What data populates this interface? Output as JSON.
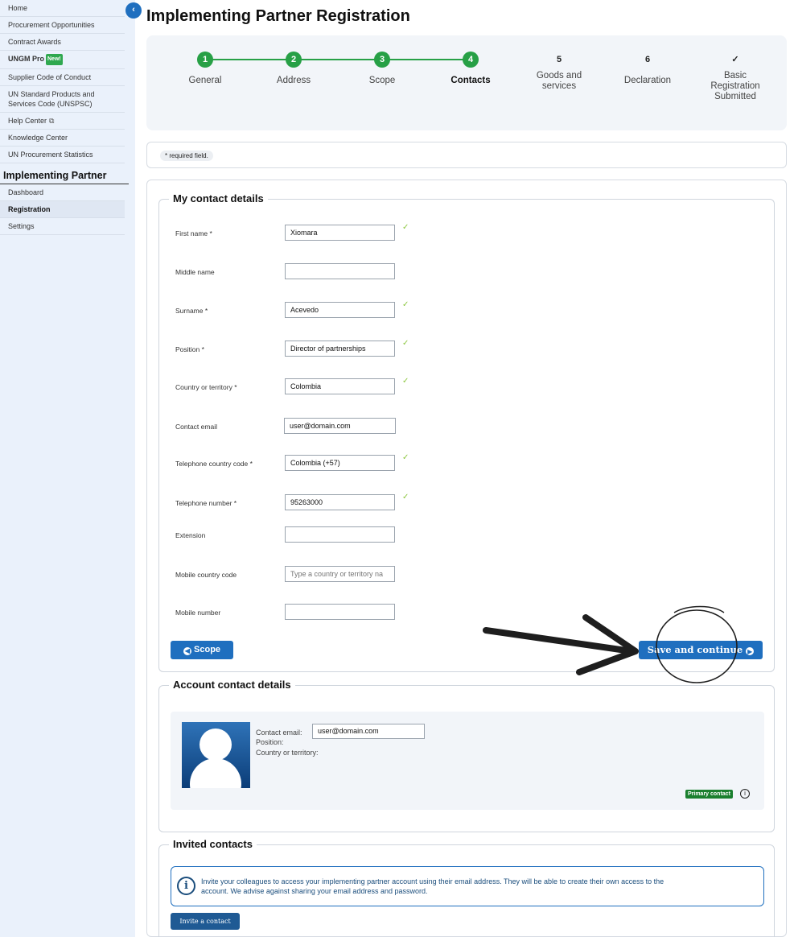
{
  "sidebar": {
    "links": [
      "Home",
      "Procurement Opportunities",
      "Contract Awards"
    ],
    "ungm_pro": "UNGM Pro",
    "new_badge": "New!",
    "links2": [
      "Supplier Code of Conduct",
      "UN Standard Products and",
      "Services Code (UNSPSC)"
    ],
    "help_center": "Help Center",
    "links3": [
      "Knowledge Center",
      "UN Procurement Statistics"
    ],
    "section": "Implementing Partner",
    "section_items": [
      "Dashboard",
      "Registration",
      "Settings"
    ]
  },
  "page": {
    "title": "Implementing Partner Registration"
  },
  "steps": [
    {
      "num": "1",
      "label": "General"
    },
    {
      "num": "2",
      "label": "Address"
    },
    {
      "num": "3",
      "label": "Scope"
    },
    {
      "num": "4",
      "label": "Contacts"
    },
    {
      "num": "5",
      "label_1": "Goods and",
      "label_2": "services"
    },
    {
      "num": "6",
      "label": "Declaration"
    },
    {
      "num": "✓",
      "label_1": "Basic",
      "label_2": "Registration",
      "label_3": "Submitted"
    }
  ],
  "required_note": "* required field.",
  "my_contact": {
    "legend": "My contact details",
    "fields": [
      {
        "label": "First name *",
        "value": "Xiomara"
      },
      {
        "label": "Middle name",
        "value": ""
      },
      {
        "label": "Surname *",
        "value": "Acevedo"
      },
      {
        "label": "Position *",
        "value": "Director of partnerships"
      },
      {
        "label": "Country or territory *",
        "value": "Colombia"
      },
      {
        "label": "Contact email",
        "value": "user@domain.com"
      },
      {
        "label": "Telephone country code *",
        "value": "Colombia (+57)"
      },
      {
        "label": "Telephone number *",
        "value": "95263000"
      },
      {
        "label": "Extension",
        "value": ""
      },
      {
        "label": "Mobile country code",
        "value": "",
        "placeholder": "Type a country or territory na"
      },
      {
        "label": "Mobile number",
        "value": ""
      }
    ],
    "back_button": "Scope",
    "save_button": "Save and continue"
  },
  "account_contact": {
    "legend": "Account contact details",
    "email_label": "Contact email:",
    "email_value": "user@domain.com",
    "position_label": "Position:",
    "country_label": "Country or territory:",
    "primary_badge": "Primary contact"
  },
  "invited": {
    "legend": "Invited contacts",
    "info_line1": "Invite your colleagues to access your implementing partner account using their email address. They will be able to create their own access to the",
    "info_line2": "account. We advise against sharing your email address and password.",
    "invite_button": "Invite a contact"
  },
  "colors": {
    "primary": "#1f6fbf",
    "step_done": "#27a046",
    "check": "#8cc63f",
    "primary_badge": "#1a7f2e"
  }
}
